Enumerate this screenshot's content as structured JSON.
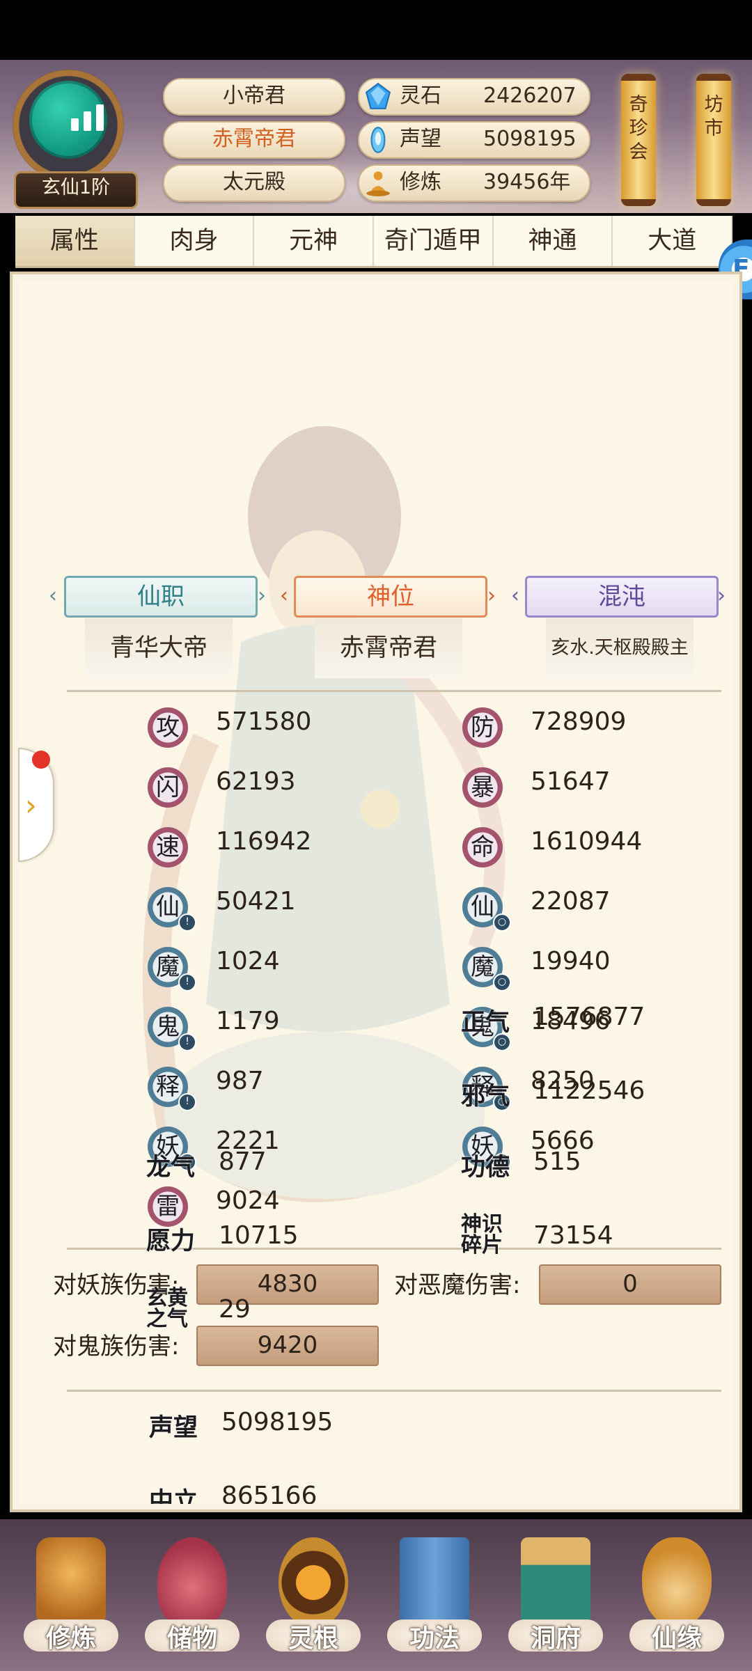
{
  "header": {
    "rank": "玄仙1阶",
    "names": [
      "小帝君",
      "赤霄帝君",
      "太元殿"
    ],
    "resources": [
      {
        "label": "灵石",
        "value": "2426207",
        "icon": "spirit-stone-icon"
      },
      {
        "label": "声望",
        "value": "5098195",
        "icon": "prestige-crystal-icon"
      },
      {
        "label": "修炼",
        "value": "39456年",
        "icon": "meditation-icon"
      }
    ],
    "lanterns": [
      "奇珍会",
      "坊市"
    ]
  },
  "tabs": [
    "属性",
    "肉身",
    "元神",
    "奇门遁甲",
    "神通",
    "大道"
  ],
  "active_tab": 0,
  "titles": [
    {
      "plaque": "仙职",
      "value": "青华大帝"
    },
    {
      "plaque": "神位",
      "value": "赤霄帝君"
    },
    {
      "plaque": "混沌",
      "value": "亥水.天枢殿殿主"
    }
  ],
  "stats_left": [
    {
      "glyph": "攻",
      "value": "571580"
    },
    {
      "glyph": "闪",
      "value": "62193"
    },
    {
      "glyph": "速",
      "value": "116942"
    },
    {
      "glyph": "仙",
      "value": "50421"
    },
    {
      "glyph": "魔",
      "value": "1024"
    },
    {
      "glyph": "鬼",
      "value": "1179"
    },
    {
      "glyph": "释",
      "value": "987"
    },
    {
      "glyph": "妖",
      "value": "2221"
    },
    {
      "glyph": "雷",
      "value": "9024"
    }
  ],
  "stats_right": [
    {
      "glyph": "防",
      "value": "728909"
    },
    {
      "glyph": "暴",
      "value": "51647"
    },
    {
      "glyph": "命",
      "value": "1610944"
    },
    {
      "glyph": "仙",
      "value": "22087"
    },
    {
      "glyph": "魔",
      "value": "19940"
    },
    {
      "glyph": "鬼",
      "value": "18496"
    },
    {
      "glyph": "释",
      "value": "8250"
    },
    {
      "glyph": "妖",
      "value": "5666"
    }
  ],
  "damage": [
    {
      "label": "对妖族伤害:",
      "value": "4830"
    },
    {
      "label": "对恶魔伤害:",
      "value": "0"
    },
    {
      "label": "对鬼族伤害:",
      "value": "9420"
    }
  ],
  "reputation": {
    "left": [
      {
        "label": "声望",
        "value": "5098195"
      },
      {
        "label": "中立",
        "value": "865166"
      },
      {
        "label": "龙气",
        "value": "877"
      },
      {
        "label": "愿力",
        "value": "10715"
      },
      {
        "label": "玄黄之气",
        "value": "29"
      }
    ],
    "right": [
      {
        "label": "正气",
        "value": "1576877"
      },
      {
        "label": "邪气",
        "value": "1122546"
      },
      {
        "label": "功德",
        "value": "515"
      },
      {
        "label": "神识碎片",
        "value": "73154"
      }
    ]
  },
  "bottom_nav": [
    "修炼",
    "储物",
    "灵根",
    "功法",
    "洞府",
    "仙缘"
  ],
  "colors": {
    "accent_orange": "#d2611f",
    "panel_bg": "#fbf6e6",
    "stat_red": "#a4536c",
    "stat_blue": "#4f7d95"
  }
}
